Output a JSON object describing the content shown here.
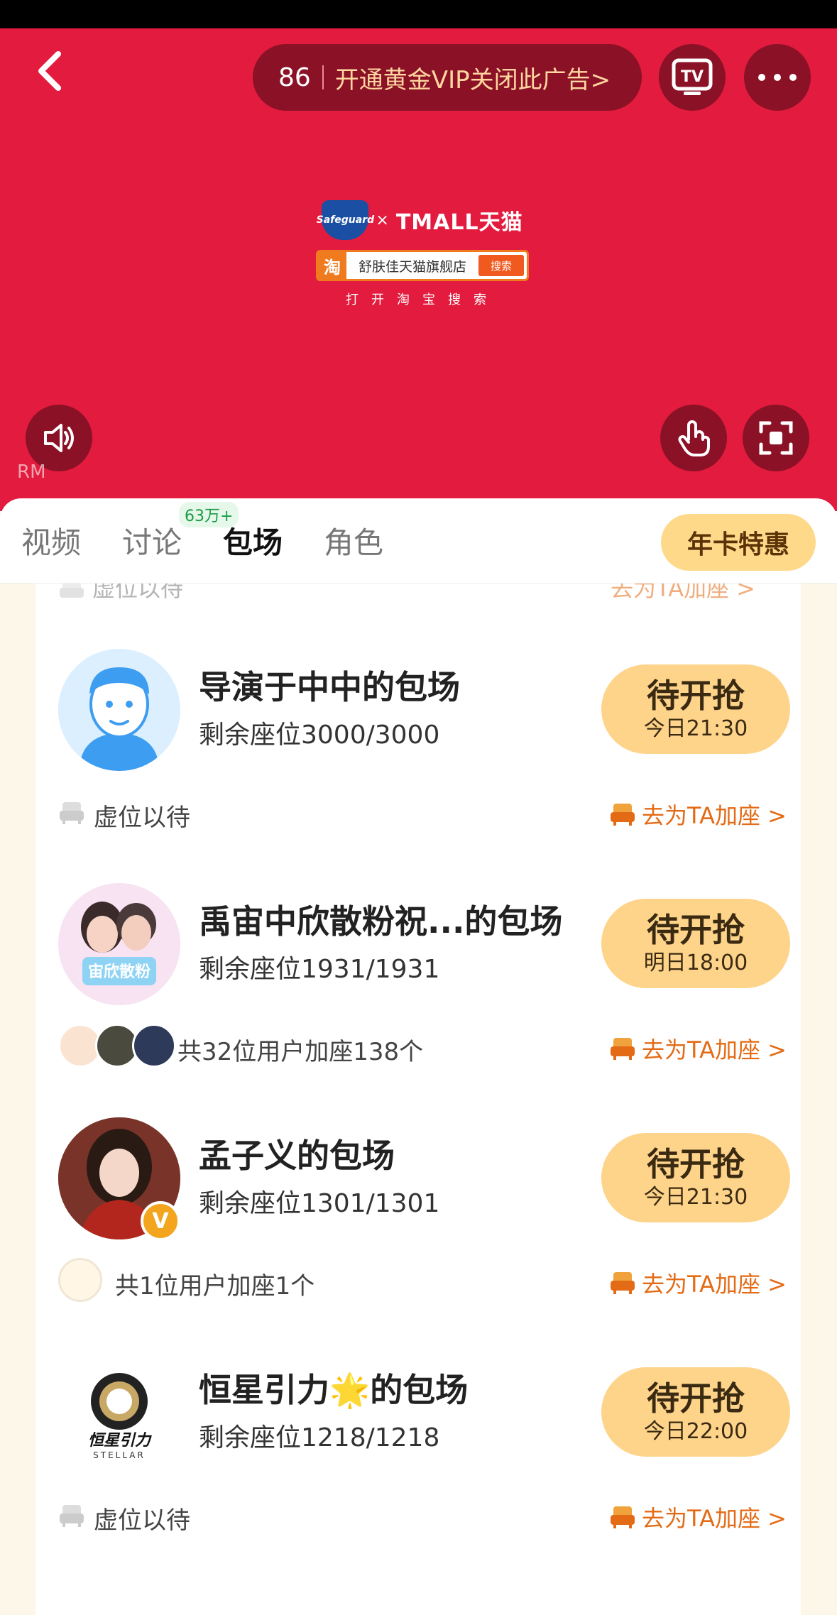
{
  "video": {
    "countdown": "86",
    "vip_text": "开通黄金VIP关闭此广告>",
    "tv_icon_label": "TV",
    "watermark": "RM",
    "ad": {
      "brand_left": "Safeguard",
      "brand_x": "×",
      "brand_right": "TMALL天猫",
      "taobao_char": "淘",
      "store_name": "舒肤佳天猫旗舰店",
      "search_tag": "搜索",
      "open_hint": "打开淘宝搜索"
    }
  },
  "tabs": [
    {
      "label": "视频"
    },
    {
      "label": "讨论",
      "badge": "63万+"
    },
    {
      "label": "包场"
    },
    {
      "label": "角色"
    }
  ],
  "annual_button": "年卡特惠",
  "peek": {
    "left": "虚位以待",
    "right": "去为TA加座 >"
  },
  "cards": [
    {
      "title": "导演于中中的包场",
      "seats": "剩余座位3000/3000",
      "status": "待开抢",
      "time": "今日21:30",
      "foot": "虚位以待",
      "add": "去为TA加座 >"
    },
    {
      "title": "禹宙中欣散粉祝...的包场",
      "seats": "剩余座位1931/1931",
      "status": "待开抢",
      "time": "明日18:00",
      "foot": "共32位用户加座138个",
      "add": "去为TA加座 >",
      "avatar_text": "宙欣散粉"
    },
    {
      "title": "孟子义的包场",
      "seats": "剩余座位1301/1301",
      "status": "待开抢",
      "time": "今日21:30",
      "foot": "共1位用户加座1个",
      "add": "去为TA加座 >",
      "badge": "V"
    },
    {
      "title": "恒星引力🌟的包场",
      "seats": "剩余座位1218/1218",
      "status": "待开抢",
      "time": "今日22:00",
      "foot": "虚位以待",
      "add": "去为TA加座 >",
      "logo_text": "恒星引力",
      "logo_sub": "STELLAR"
    }
  ],
  "colors": {
    "ad_red": "#e31b3e",
    "button_yellow": "#fed48b",
    "accent_orange": "#e46b16"
  }
}
